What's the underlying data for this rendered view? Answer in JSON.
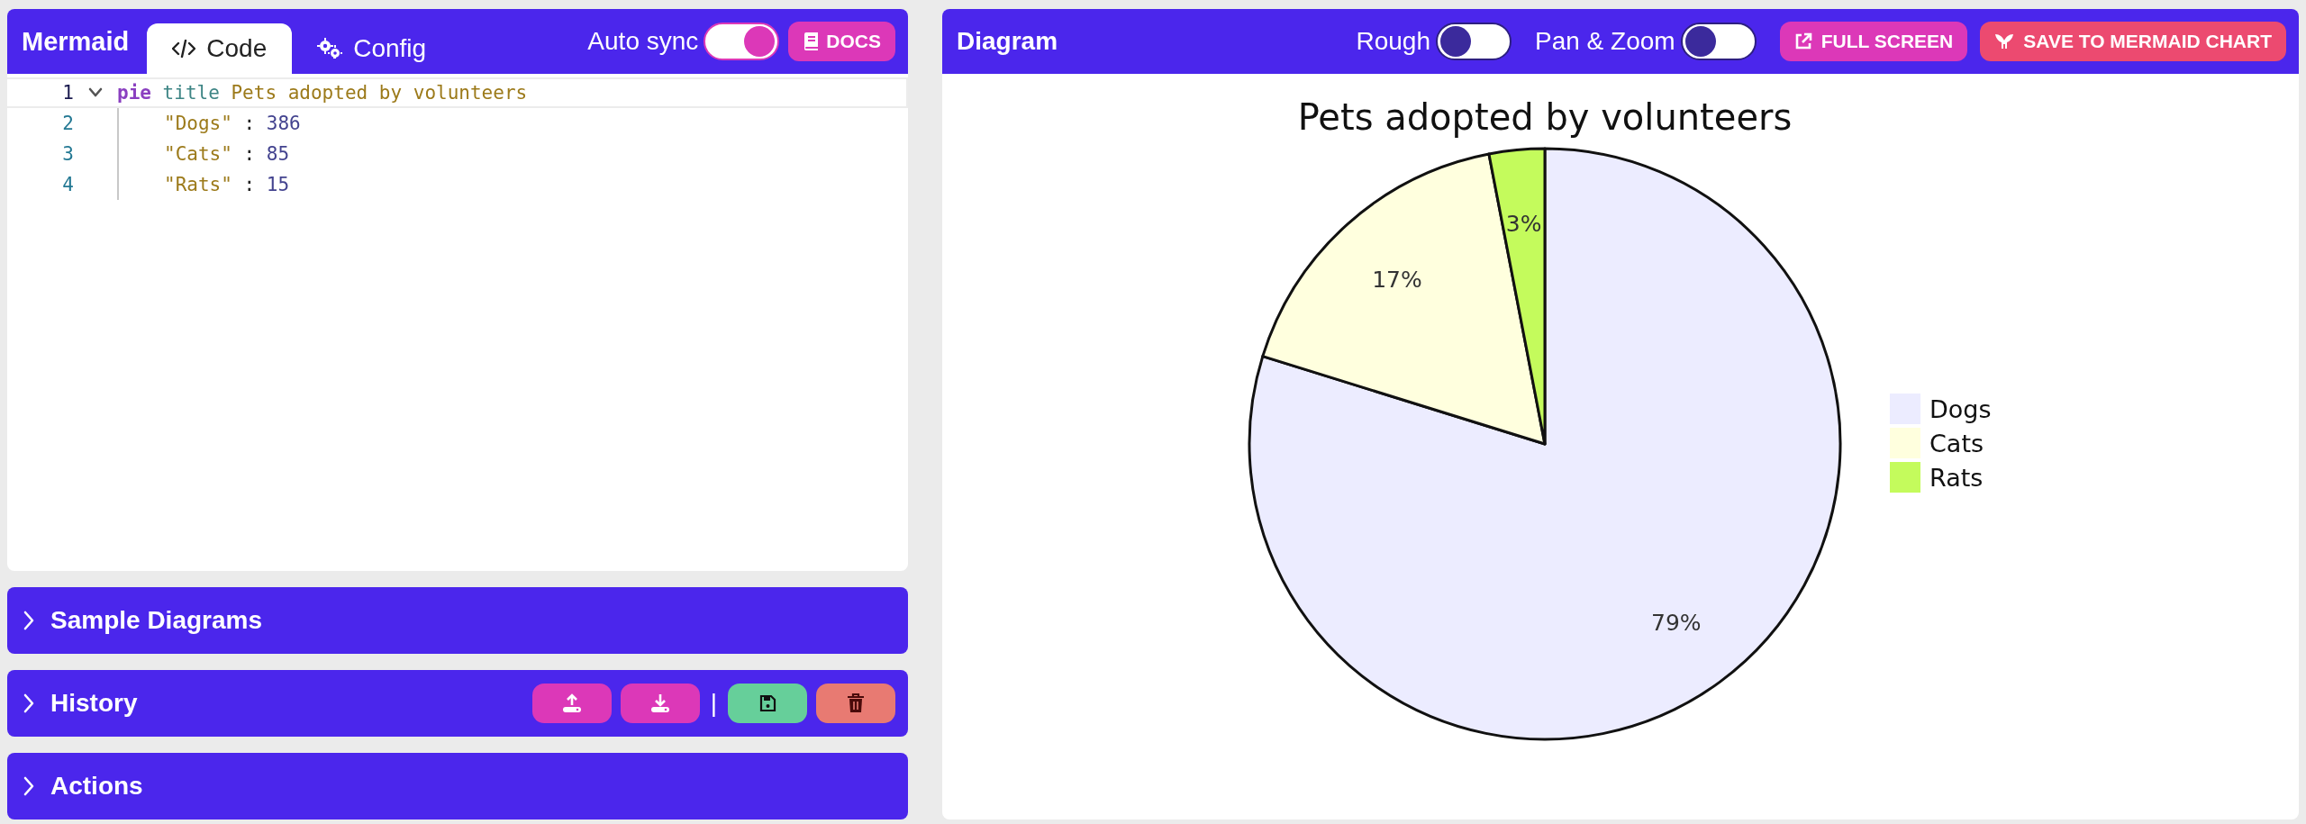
{
  "editor": {
    "brand": "Mermaid",
    "tabs": [
      {
        "label": "Code",
        "selected": true
      },
      {
        "label": "Config",
        "selected": false
      }
    ],
    "auto_sync": {
      "label": "Auto sync",
      "on": true
    },
    "docs_button": "DOCS",
    "lines": [
      {
        "number": "1",
        "active": true,
        "expanded": true,
        "tokens": [
          {
            "kind": "keyword",
            "text": "pie"
          },
          {
            "kind": "attribute",
            "text": "title"
          },
          {
            "kind": "string",
            "text": "Pets adopted by volunteers"
          }
        ],
        "children": [
          {
            "number": "2",
            "active": false,
            "tokens": [
              {
                "kind": "string",
                "text": "\"Dogs\""
              },
              {
                "kind": "punct",
                "text": ":"
              },
              {
                "kind": "number",
                "text": "386"
              }
            ]
          },
          {
            "number": "3",
            "active": false,
            "tokens": [
              {
                "kind": "string",
                "text": "\"Cats\""
              },
              {
                "kind": "punct",
                "text": ":"
              },
              {
                "kind": "number",
                "text": "85"
              }
            ]
          },
          {
            "number": "4",
            "active": false,
            "tokens": [
              {
                "kind": "string",
                "text": "\"Rats\""
              },
              {
                "kind": "punct",
                "text": ":"
              },
              {
                "kind": "number",
                "text": "15"
              }
            ]
          }
        ]
      }
    ]
  },
  "sections": [
    {
      "title": "Sample Diagrams",
      "expanded": false
    },
    {
      "title": "History",
      "expanded": false,
      "buttons": [
        {
          "kind": "upload"
        },
        {
          "kind": "download"
        },
        {
          "kind": "separator",
          "text": "|"
        },
        {
          "kind": "save"
        },
        {
          "kind": "delete"
        }
      ]
    },
    {
      "title": "Actions",
      "expanded": false
    }
  ],
  "diagram": {
    "title": "Diagram",
    "toggles": [
      {
        "label": "Rough",
        "on": false
      },
      {
        "label": "Pan & Zoom",
        "on": false
      }
    ],
    "buttons": [
      {
        "kind": "fullscreen",
        "label": "FULL SCREEN"
      },
      {
        "kind": "mermaid-chart",
        "label": "SAVE TO MERMAID CHART"
      }
    ],
    "chart_data": {
      "type": "pie",
      "title": "Pets adopted by volunteers",
      "categories": [
        "Dogs",
        "Cats",
        "Rats"
      ],
      "values": [
        79,
        17,
        3
      ],
      "legend": true,
      "colors": [
        "#ececff",
        "#ffffde",
        "#c4fb5c"
      ],
      "value_labels": [
        "79%",
        "17%",
        "3%"
      ]
    }
  }
}
